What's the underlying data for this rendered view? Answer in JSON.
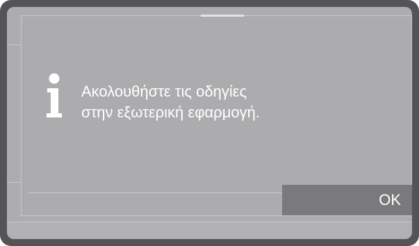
{
  "dialog": {
    "type": "information",
    "icon": "info-icon",
    "message_lines": [
      "Ακολουθήστε τις οδηγίες",
      "στην εξωτερική εφαρμογή."
    ],
    "ok_label": "OK"
  },
  "colors": {
    "frame": "#545456",
    "screen_background": "#adadaf",
    "dialog_border": "#cbcbcd",
    "text": "#ffffff",
    "ok_button_background": "#7a7a7c"
  }
}
